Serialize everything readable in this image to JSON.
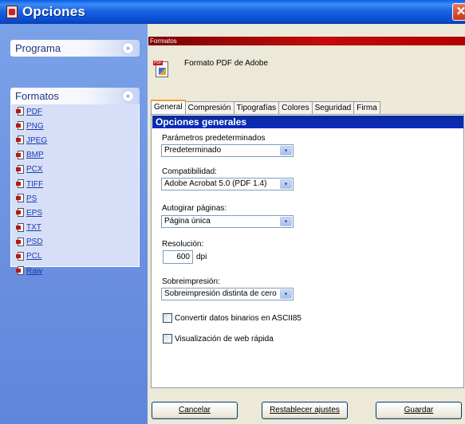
{
  "window": {
    "title": "Opciones",
    "close_glyph": "✕"
  },
  "sidebar": {
    "groups": [
      {
        "label": "Programa",
        "chevron": "»"
      },
      {
        "label": "Formatos",
        "chevron": "«"
      }
    ],
    "formats": [
      "PDF",
      "PNG",
      "JPEG",
      "BMP",
      "PCX",
      "TIFF",
      "PS",
      "EPS",
      "TXT",
      "PSD",
      "PCL",
      "Raw"
    ]
  },
  "main": {
    "section_title": "Formatos",
    "format_description": "Formato PDF de Adobe",
    "pdf_tag": "PDF",
    "tabs": [
      "General",
      "Compresión",
      "Tipografías",
      "Colores",
      "Seguridad",
      "Firma"
    ],
    "active_tab": 0,
    "options_title": "Opciones generales",
    "presets": {
      "label": "Parámetros predeterminados",
      "value": "Predeterminado"
    },
    "compat": {
      "label": "Compatibilidad:",
      "value": "Adobe Acrobat 5.0 (PDF 1.4)"
    },
    "autorotate": {
      "label": "Autogirar páginas:",
      "value": "Página única"
    },
    "resolution": {
      "label": "Resolución:",
      "value": "600",
      "unit": "dpi"
    },
    "overprint": {
      "label": "Sobreimpresión:",
      "value": "Sobreimpresión distinta de cero"
    },
    "check_ascii": {
      "label": "Convertir datos binarios en ASCII85",
      "checked": false
    },
    "check_fastweb": {
      "label": "Visualización de web rápida",
      "checked": false
    }
  },
  "footer": {
    "cancel": "Cancelar",
    "reset": "Restablecer ajustes",
    "save": "Guardar"
  },
  "icons": {
    "dropdown": "▾"
  }
}
